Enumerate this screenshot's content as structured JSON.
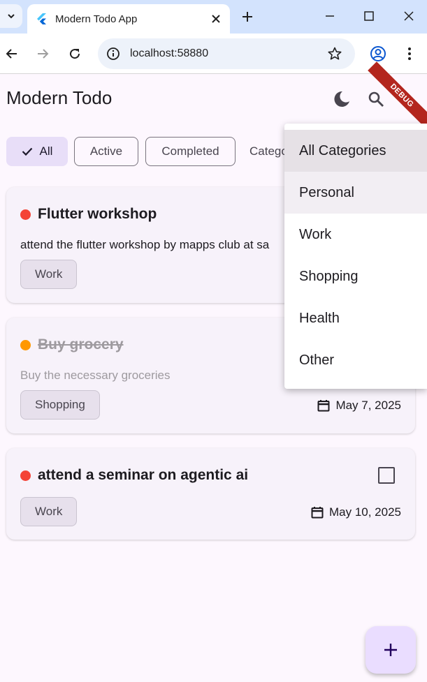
{
  "browser": {
    "tab_title": "Modern Todo App",
    "url": "localhost:58880"
  },
  "app": {
    "title": "Modern Todo",
    "debug_banner": "DEBUG",
    "filters": [
      "All",
      "Active",
      "Completed"
    ],
    "category_label": "Categor",
    "accent_color": "#e8def8"
  },
  "todos": [
    {
      "title": "Flutter workshop",
      "description": "attend the flutter workshop by mapps club at sa",
      "category": "Work",
      "priority_color": "#f44336",
      "completed": false
    },
    {
      "title": "Buy grocery",
      "description": "Buy the necessary groceries",
      "category": "Shopping",
      "due": "May 7, 2025",
      "priority_color": "#ff9800",
      "completed": true
    },
    {
      "title": "attend a seminar on agentic ai",
      "category": "Work",
      "due": "May 10, 2025",
      "priority_color": "#f44336",
      "completed": false
    }
  ],
  "category_menu": {
    "items": [
      "All Categories",
      "Personal",
      "Work",
      "Shopping",
      "Health",
      "Other"
    ],
    "selected": "All Categories"
  },
  "icons": {
    "theme": "dark-mode-icon",
    "search": "search-icon",
    "fab": "plus-icon"
  }
}
